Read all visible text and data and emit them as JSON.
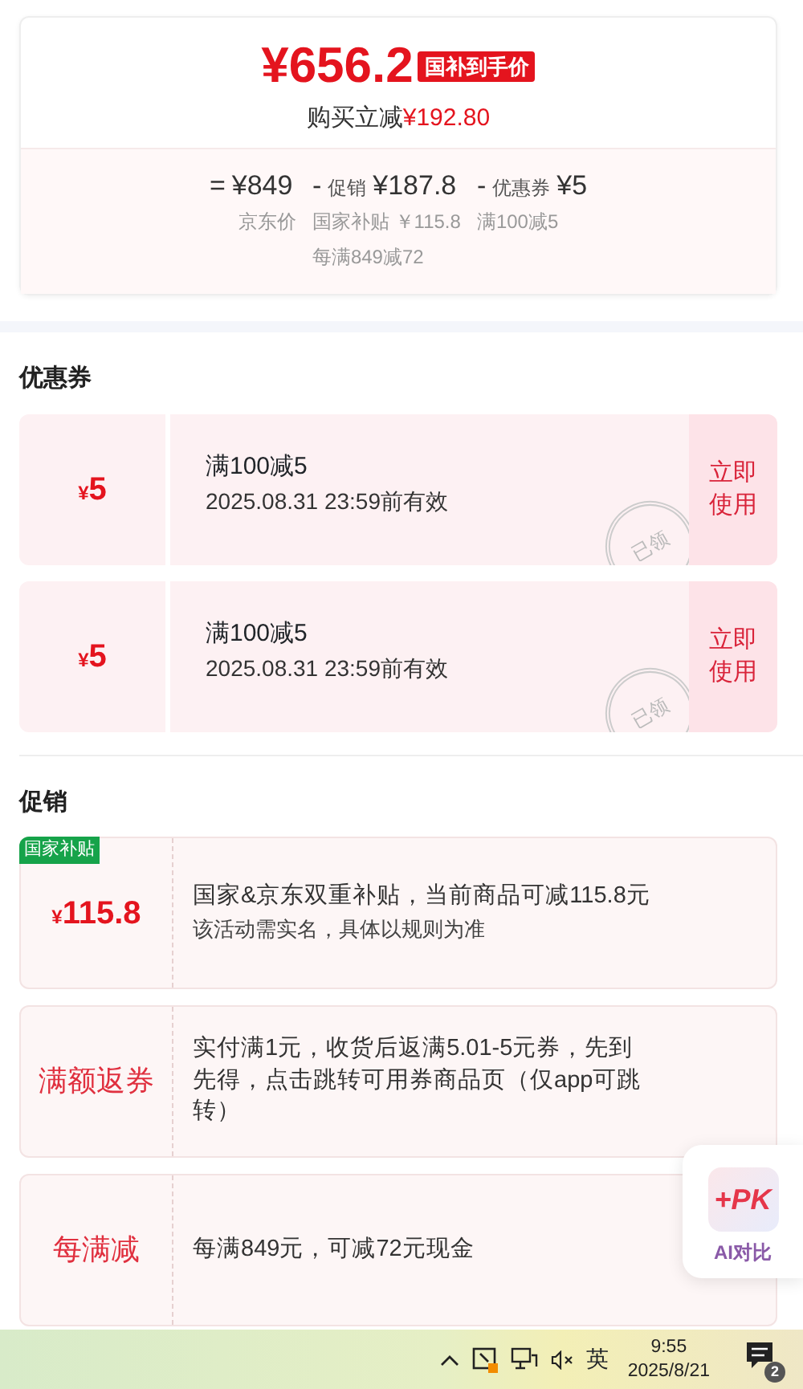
{
  "price_card": {
    "price": "¥656.2",
    "price_tag": "国补到手价",
    "saving_label": "购买立减",
    "saving_amount": "¥192.80",
    "breakdown": [
      {
        "op": "=",
        "amount": "¥849",
        "notes": [
          "京东价"
        ]
      },
      {
        "op": "-",
        "label": "促销",
        "amount": "¥187.8",
        "notes": [
          "国家补贴 ￥115.8",
          "每满849减72"
        ]
      },
      {
        "op": "-",
        "label": "优惠券",
        "amount": "¥5",
        "notes": [
          "满100减5"
        ]
      }
    ]
  },
  "coupons_title": "优惠券",
  "coupons": [
    {
      "currency": "¥",
      "amount": "5",
      "title": "满100减5",
      "validity": "2025.08.31 23:59前有效",
      "stamp": "已领",
      "action": "立即使用"
    },
    {
      "currency": "¥",
      "amount": "5",
      "title": "满100减5",
      "validity": "2025.08.31 23:59前有效",
      "stamp": "已领",
      "action": "立即使用"
    }
  ],
  "promotions_title": "促销",
  "promotions": [
    {
      "kind": "amount",
      "tag": "国家补贴",
      "currency": "¥",
      "amount": "115.8",
      "lines": [
        "国家&京东双重补贴，当前商品可减115.8元",
        "该活动需实名，具体以规则为准"
      ]
    },
    {
      "kind": "label",
      "label": "满额返券",
      "lines": [
        "实付满1元，收货后返满5.01-5元券，先到先得，点击跳转可用券商品页（仅app可跳转）"
      ]
    },
    {
      "kind": "label",
      "label": "每满减",
      "lines": [
        "每满849元，可减72元现金"
      ]
    }
  ],
  "compare_widget": {
    "logo": "+PK",
    "label": "AI对比"
  },
  "taskbar": {
    "ime": "英",
    "time": "9:55",
    "date": "2025/8/21",
    "notifications": "2"
  }
}
